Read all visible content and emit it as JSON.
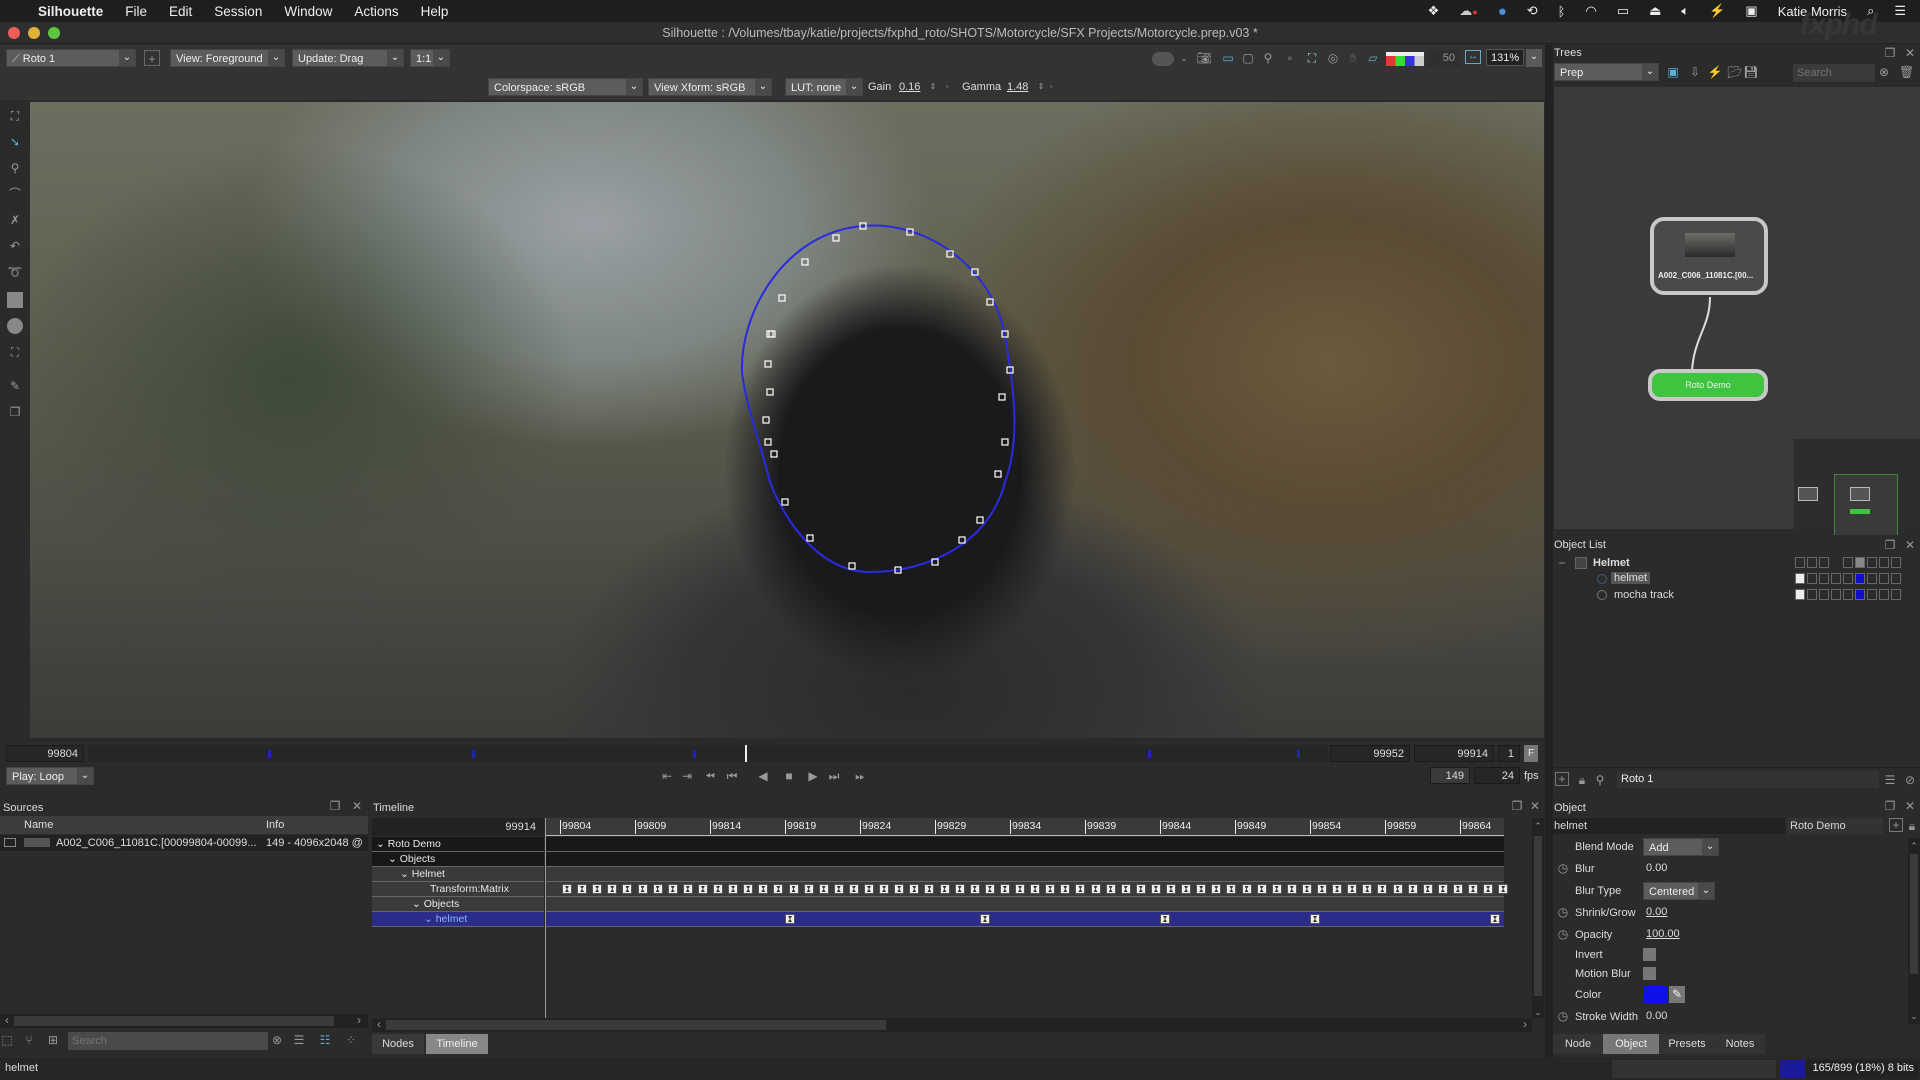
{
  "menubar": {
    "apple": "",
    "app": "Silhouette",
    "items": [
      "File",
      "Edit",
      "Session",
      "Window",
      "Actions",
      "Help"
    ],
    "user": "Katie Morris"
  },
  "window": {
    "title": "Silhouette : /Volumes/tbay/katie/projects/fxphd_roto/SHOTS/Motorcycle/SFX Projects/Motorcycle.prep.v03 *"
  },
  "toolbar": {
    "node_select": "Roto 1",
    "view": "View: Foreground",
    "update": "Update: Drag",
    "ratio": "1:1",
    "colorspace": "Colorspace: sRGB",
    "view_xform": "View Xform: sRGB",
    "lut": "LUT: none",
    "gain_label": "Gain",
    "gain": "0.16",
    "gamma_label": "Gamma",
    "gamma": "1.48",
    "opacity_value": "50",
    "zoom": "131%"
  },
  "tools": [
    "transform-tool",
    "reshape-tool",
    "ik-tool",
    "bspline-tool",
    "xspline-tool",
    "bezier-tool",
    "magnetic-tool",
    "rectangle-tool",
    "ellipse-tool",
    "tracker-tool",
    "paint-tool",
    "layers-tool"
  ],
  "timebar": {
    "start": "99804",
    "end": "99952",
    "current": "99914",
    "step": "1",
    "f_button": "F",
    "duration": "149",
    "fps": "24",
    "fps_label": "fps",
    "play_mode": "Play: Loop",
    "keyframe_positions": [
      0.145,
      0.31,
      0.488,
      0.855,
      0.975
    ],
    "playhead": 0.53
  },
  "sources": {
    "title": "Sources",
    "columns": [
      "Name",
      "Info"
    ],
    "rows": [
      {
        "name": "A002_C006_11081C.[00099804-00099...",
        "info": "149 - 4096x2048 @"
      }
    ],
    "search_placeholder": "Search"
  },
  "timeline": {
    "title": "Timeline",
    "current_frame": "99914",
    "ticks": [
      "99804",
      "99809",
      "99814",
      "99819",
      "99824",
      "99829",
      "99834",
      "99839",
      "99844",
      "99849",
      "99854",
      "99859",
      "99864"
    ],
    "rows": [
      {
        "label": "Roto Demo",
        "indent": 0,
        "expanded": true
      },
      {
        "label": "Objects",
        "indent": 1,
        "expanded": true
      },
      {
        "label": "Helmet",
        "indent": 2,
        "expanded": true
      },
      {
        "label": "Transform:Matrix",
        "indent": 3,
        "expanded": null
      },
      {
        "label": "Objects",
        "indent": 3,
        "expanded": true
      },
      {
        "label": "helmet",
        "indent": 4,
        "expanded": true,
        "selected": true
      }
    ],
    "helmet_keyframes": [
      "99819",
      "99832",
      "99844",
      "99854",
      "99866"
    ],
    "tabs": [
      "Nodes",
      "Timeline"
    ],
    "active_tab": "Timeline"
  },
  "trees": {
    "title": "Trees",
    "selected": "Prep",
    "search_placeholder": "Search",
    "nodes": [
      {
        "label": "A002_C006_11081C.[00...",
        "type": "source"
      },
      {
        "label": "Roto Demo",
        "type": "roto",
        "color": "#3ec43e"
      }
    ]
  },
  "object_list": {
    "title": "Object List",
    "items": [
      {
        "label": "Helmet",
        "type": "layer",
        "bold": true
      },
      {
        "label": "helmet",
        "type": "shape",
        "selected": true
      },
      {
        "label": "mocha track",
        "type": "shape"
      }
    ],
    "filter": "Roto 1"
  },
  "object": {
    "title": "Object",
    "name": "helmet",
    "node": "Roto Demo",
    "props": {
      "blend_mode_label": "Blend Mode",
      "blend_mode": "Add",
      "blur_label": "Blur",
      "blur": "0.00",
      "blur_type_label": "Blur Type",
      "blur_type": "Centered",
      "shrink_label": "Shrink/Grow",
      "shrink": "0.00",
      "opacity_label": "Opacity",
      "opacity": "100.00",
      "invert_label": "Invert",
      "motion_blur_label": "Motion Blur",
      "color_label": "Color",
      "color": "#1010e8",
      "stroke_label": "Stroke Width",
      "stroke": "0.00"
    },
    "tabs": [
      "Node",
      "Object",
      "Presets",
      "Notes"
    ],
    "active_tab": "Object"
  },
  "status": {
    "left": "helmet",
    "memory": "165/899 (18%) 8 bits",
    "memory_fraction": 0.18
  },
  "overlay_logo": "fxphd"
}
